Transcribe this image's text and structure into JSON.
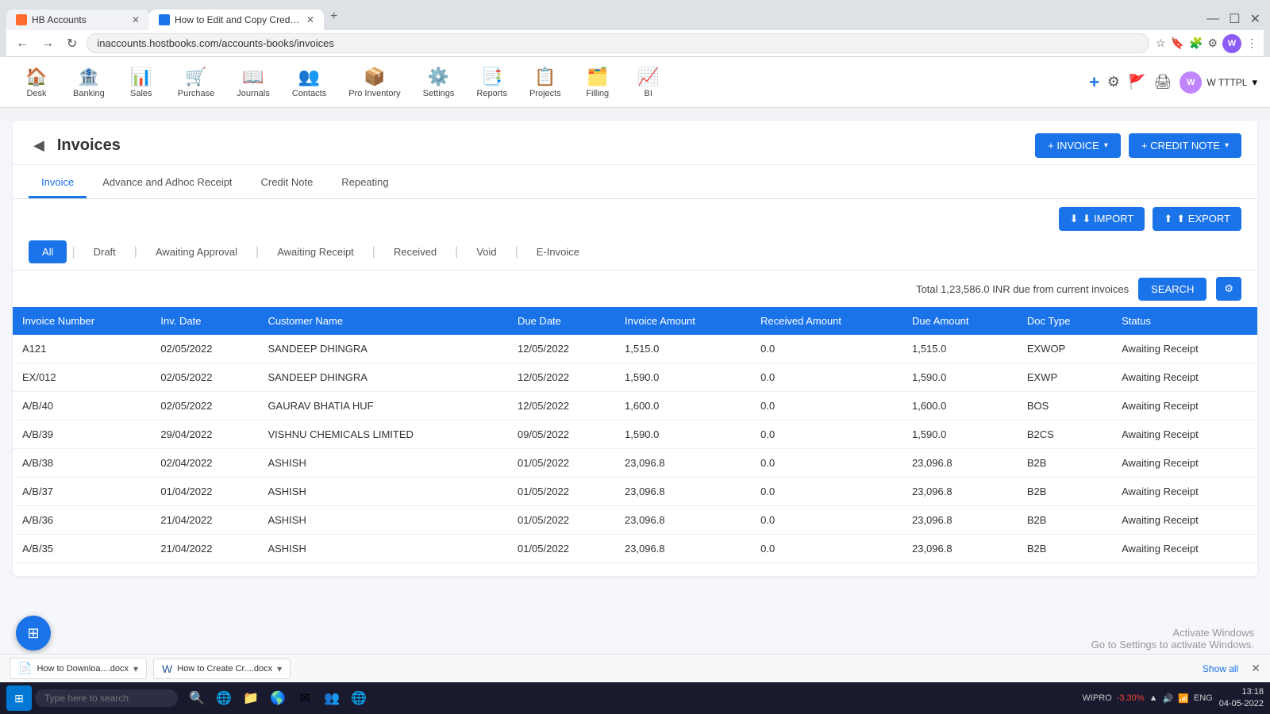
{
  "browser": {
    "tabs": [
      {
        "id": "tab1",
        "title": "HB Accounts",
        "icon_type": "orange",
        "active": false
      },
      {
        "id": "tab2",
        "title": "How to Edit and Copy Credit No...",
        "icon_type": "blue",
        "active": true
      }
    ],
    "address": "inaccounts.hostbooks.com/accounts-books/invoices",
    "new_tab_label": "+",
    "window_controls": [
      "—",
      "☐",
      "✕"
    ]
  },
  "nav": {
    "items": [
      {
        "id": "desk",
        "label": "Desk",
        "icon": "🏠"
      },
      {
        "id": "banking",
        "label": "Banking",
        "icon": "🏦"
      },
      {
        "id": "sales",
        "label": "Sales",
        "icon": "📊"
      },
      {
        "id": "purchase",
        "label": "Purchase",
        "icon": "🛒"
      },
      {
        "id": "journals",
        "label": "Journals",
        "icon": "📖"
      },
      {
        "id": "contacts",
        "label": "Contacts",
        "icon": "👥"
      },
      {
        "id": "pro_inventory",
        "label": "Pro Inventory",
        "icon": "📦"
      },
      {
        "id": "settings",
        "label": "Settings",
        "icon": "⚙️"
      },
      {
        "id": "reports",
        "label": "Reports",
        "icon": "📑"
      },
      {
        "id": "projects",
        "label": "Projects",
        "icon": "📋"
      },
      {
        "id": "filling",
        "label": "Filling",
        "icon": "🗂️"
      },
      {
        "id": "bi",
        "label": "BI",
        "icon": "📈"
      }
    ],
    "actions": {
      "add": "+",
      "settings": "⚙",
      "flag": "🚩",
      "print": "🖨",
      "profile_initials": "W",
      "company": "W TTTPL",
      "chevron": "▾"
    }
  },
  "page": {
    "title": "Invoices",
    "back_label": "◀",
    "buttons": {
      "invoice_label": "+ INVOICE",
      "invoice_dropdown": "▾",
      "credit_note_label": "+ CREDIT NOTE",
      "credit_note_dropdown": "▾"
    },
    "main_tabs": [
      {
        "id": "invoice",
        "label": "Invoice",
        "active": true
      },
      {
        "id": "advance",
        "label": "Advance and Adhoc Receipt",
        "active": false
      },
      {
        "id": "credit_note",
        "label": "Credit Note",
        "active": false
      },
      {
        "id": "repeating",
        "label": "Repeating",
        "active": false
      }
    ],
    "toolbar": {
      "import_label": "⬇ IMPORT",
      "export_label": "⬆ EXPORT"
    },
    "status_tabs": [
      {
        "id": "all",
        "label": "All",
        "active": true
      },
      {
        "id": "draft",
        "label": "Draft",
        "active": false
      },
      {
        "id": "awaiting_approval",
        "label": "Awaiting Approval",
        "active": false
      },
      {
        "id": "awaiting_receipt",
        "label": "Awaiting Receipt",
        "active": false
      },
      {
        "id": "received",
        "label": "Received",
        "active": false
      },
      {
        "id": "void",
        "label": "Void",
        "active": false
      },
      {
        "id": "einvoice",
        "label": "E-Invoice",
        "active": false
      }
    ],
    "summary": {
      "text": "Total 1,23,586.0 INR due from current invoices",
      "search_label": "SEARCH",
      "settings_icon": "⚙"
    },
    "table": {
      "headers": [
        "Invoice Number",
        "Inv. Date",
        "Customer Name",
        "Due Date",
        "Invoice Amount",
        "Received Amount",
        "Due Amount",
        "Doc Type",
        "Status"
      ],
      "rows": [
        {
          "invoice_number": "A121",
          "inv_date": "02/05/2022",
          "customer_name": "SANDEEP DHINGRA",
          "due_date": "12/05/2022",
          "invoice_amount": "1,515.0",
          "received_amount": "0.0",
          "due_amount": "1,515.0",
          "doc_type": "EXWOP",
          "status": "Awaiting Receipt"
        },
        {
          "invoice_number": "EX/012",
          "inv_date": "02/05/2022",
          "customer_name": "SANDEEP DHINGRA",
          "due_date": "12/05/2022",
          "invoice_amount": "1,590.0",
          "received_amount": "0.0",
          "due_amount": "1,590.0",
          "doc_type": "EXWP",
          "status": "Awaiting Receipt"
        },
        {
          "invoice_number": "A/B/40",
          "inv_date": "02/05/2022",
          "customer_name": "GAURAV BHATIA HUF",
          "due_date": "12/05/2022",
          "invoice_amount": "1,600.0",
          "received_amount": "0.0",
          "due_amount": "1,600.0",
          "doc_type": "BOS",
          "status": "Awaiting Receipt"
        },
        {
          "invoice_number": "A/B/39",
          "inv_date": "29/04/2022",
          "customer_name": "VISHNU CHEMICALS LIMITED",
          "due_date": "09/05/2022",
          "invoice_amount": "1,590.0",
          "received_amount": "0.0",
          "due_amount": "1,590.0",
          "doc_type": "B2CS",
          "status": "Awaiting Receipt"
        },
        {
          "invoice_number": "A/B/38",
          "inv_date": "02/04/2022",
          "customer_name": "ASHISH",
          "due_date": "01/05/2022",
          "invoice_amount": "23,096.8",
          "received_amount": "0.0",
          "due_amount": "23,096.8",
          "doc_type": "B2B",
          "status": "Awaiting Receipt"
        },
        {
          "invoice_number": "A/B/37",
          "inv_date": "01/04/2022",
          "customer_name": "ASHISH",
          "due_date": "01/05/2022",
          "invoice_amount": "23,096.8",
          "received_amount": "0.0",
          "due_amount": "23,096.8",
          "doc_type": "B2B",
          "status": "Awaiting Receipt"
        },
        {
          "invoice_number": "A/B/36",
          "inv_date": "21/04/2022",
          "customer_name": "ASHISH",
          "due_date": "01/05/2022",
          "invoice_amount": "23,096.8",
          "received_amount": "0.0",
          "due_amount": "23,096.8",
          "doc_type": "B2B",
          "status": "Awaiting Receipt"
        },
        {
          "invoice_number": "A/B/35",
          "inv_date": "21/04/2022",
          "customer_name": "ASHISH",
          "due_date": "01/05/2022",
          "invoice_amount": "23,096.8",
          "received_amount": "0.0",
          "due_amount": "23,096.8",
          "doc_type": "B2B",
          "status": "Awaiting Receipt"
        }
      ]
    }
  },
  "download_bar": {
    "items": [
      {
        "id": "dl1",
        "name": "How to Downloa....docx",
        "icon": "📄"
      },
      {
        "id": "dl2",
        "name": "How to Create Cr....docx",
        "icon": "📄"
      }
    ],
    "show_all_label": "Show all",
    "close_label": "✕"
  },
  "taskbar": {
    "search_placeholder": "Type here to search",
    "apps": [
      "⊞",
      "🔍",
      "🌐",
      "📁",
      "📧",
      "🎵",
      "🌎"
    ],
    "tray": {
      "stock": "WIPRO",
      "change": "-3.30%",
      "time": "13:18",
      "date": "04-05-2022"
    }
  },
  "activation": {
    "line1": "Activate Windows",
    "line2": "Go to Settings to activate Windows."
  }
}
